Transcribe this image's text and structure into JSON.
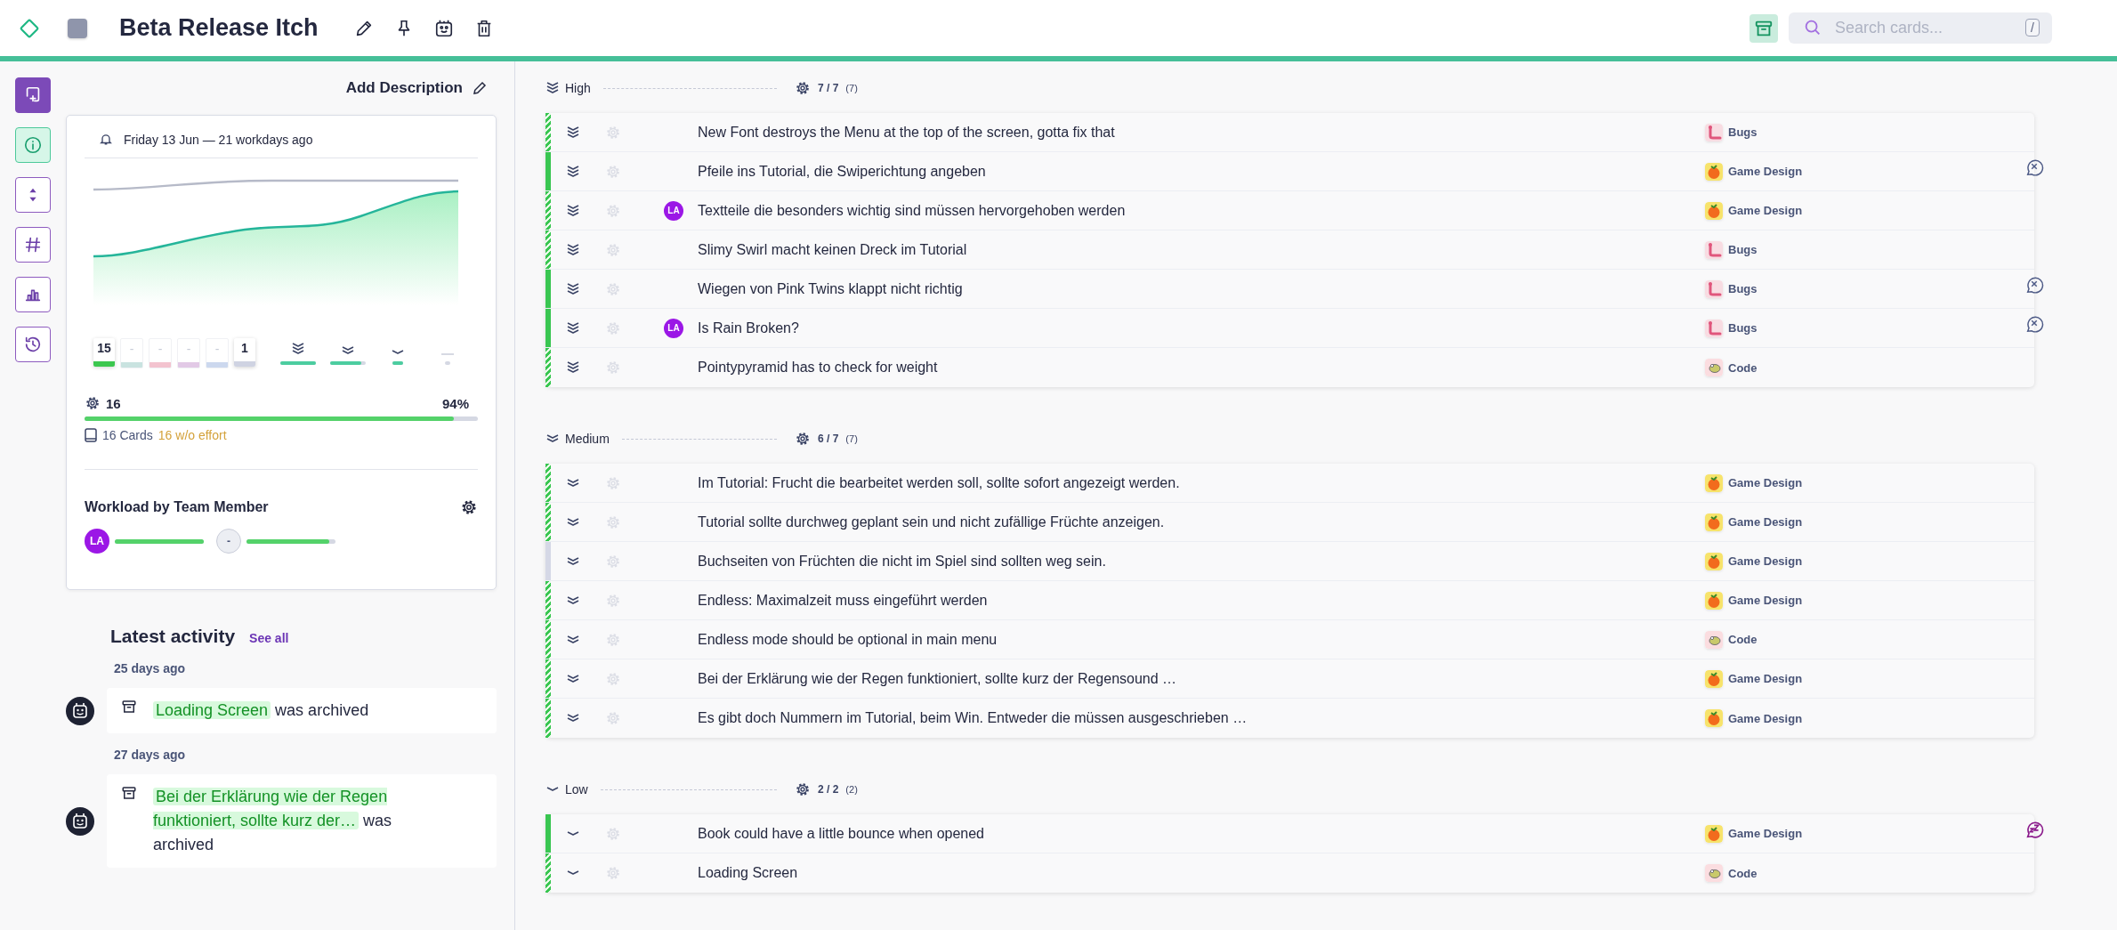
{
  "header": {
    "title": "Beta Release Itch",
    "search": {
      "placeholder": "Search cards...",
      "shortcut": "/"
    }
  },
  "rail": [
    {
      "kind": "action",
      "selected": false
    },
    {
      "kind": "tab",
      "selected": true
    },
    {
      "kind": "tab",
      "selected": false
    },
    {
      "kind": "tab",
      "selected": false
    },
    {
      "kind": "tab",
      "selected": false
    },
    {
      "kind": "tab",
      "selected": false
    }
  ],
  "panel": {
    "add_description": "Add Description",
    "due": "Friday 13 Jun — 21 workdays ago",
    "status_counts": [
      {
        "value": "15",
        "color": "#3cc74f",
        "empty": false
      },
      {
        "value": "-",
        "color": "#c9e3e0",
        "empty": true
      },
      {
        "value": "-",
        "color": "#f3c3cf",
        "empty": true
      },
      {
        "value": "-",
        "color": "#e2c9e6",
        "empty": true
      },
      {
        "value": "-",
        "color": "#ccd8ee",
        "empty": true
      },
      {
        "value": "1",
        "color": "#cfd3e2",
        "empty": false
      }
    ],
    "priority_bars": [
      {
        "kind": "high",
        "level": 1
      },
      {
        "kind": "medium",
        "level": 0.88
      },
      {
        "kind": "low",
        "level": 1
      },
      {
        "kind": "none"
      }
    ],
    "effort": {
      "value": "16",
      "percent": "94%",
      "level": 0.94,
      "cards": "16 Cards",
      "no_effort": "16 w/o effort"
    },
    "workload": {
      "title": "Workload by Team Member",
      "members": [
        {
          "initials": "LA",
          "kind": "user",
          "level": 1
        },
        {
          "initials": "-",
          "kind": "unassigned",
          "level": 0.93
        }
      ]
    },
    "activity": {
      "title": "Latest activity",
      "see_all": "See all",
      "entries": [
        {
          "date": "25 days ago",
          "card": "Loading Screen",
          "action": "was archived"
        },
        {
          "date": "27 days ago",
          "card": "Bei der Erklärung wie der Regen funktioniert, sollte kurz der…",
          "action": "was archived"
        }
      ]
    }
  },
  "groups": [
    {
      "kind": "high",
      "label": "High",
      "done": "7 / 7",
      "total": "(7)",
      "cards": [
        {
          "title": "New Font destroys the Menu at the top of the screen, gotta fix that",
          "tag": {
            "label": "Bugs",
            "kind": "bugs"
          },
          "kind": "striped",
          "blocked": false,
          "snoozed": false
        },
        {
          "title": "Pfeile ins Tutorial, die Swiperichtung angeben",
          "tag": {
            "label": "Game Design",
            "kind": "design"
          },
          "kind": "solid",
          "blocked": true,
          "snoozed": false
        },
        {
          "title": "Textteile die besonders wichtig sind müssen hervorgehoben werden",
          "tag": {
            "label": "Game Design",
            "kind": "design"
          },
          "kind": "striped",
          "assignee": "LA",
          "blocked": false,
          "snoozed": false
        },
        {
          "title": "Slimy Swirl macht keinen Dreck im Tutorial",
          "tag": {
            "label": "Bugs",
            "kind": "bugs"
          },
          "kind": "striped",
          "blocked": false,
          "snoozed": false
        },
        {
          "title": "Wiegen von Pink Twins klappt nicht richtig",
          "tag": {
            "label": "Bugs",
            "kind": "bugs"
          },
          "kind": "solid",
          "blocked": true,
          "snoozed": false
        },
        {
          "title": "Is Rain Broken?",
          "tag": {
            "label": "Bugs",
            "kind": "bugs"
          },
          "kind": "solid",
          "assignee": "LA",
          "blocked": true,
          "snoozed": false
        },
        {
          "title": "Pointypyramid has to check for weight",
          "tag": {
            "label": "Code",
            "kind": "code"
          },
          "kind": "striped",
          "blocked": false,
          "snoozed": false
        }
      ]
    },
    {
      "kind": "medium",
      "label": "Medium",
      "done": "6 / 7",
      "total": "(7)",
      "cards": [
        {
          "title": "Im Tutorial: Frucht die bearbeitet werden soll, sollte sofort angezeigt werden.",
          "tag": {
            "label": "Game Design",
            "kind": "design"
          },
          "kind": "striped",
          "blocked": false,
          "snoozed": false
        },
        {
          "title": "Tutorial sollte durchweg geplant sein und nicht zufällige Früchte anzeigen.",
          "tag": {
            "label": "Game Design",
            "kind": "design"
          },
          "kind": "striped",
          "blocked": false,
          "snoozed": false
        },
        {
          "title": "Buchseiten von Früchten die nicht im Spiel sind sollten weg sein.",
          "tag": {
            "label": "Game Design",
            "kind": "design"
          },
          "kind": "empty",
          "blocked": false,
          "snoozed": false
        },
        {
          "title": "Endless: Maximalzeit muss eingeführt werden",
          "tag": {
            "label": "Game Design",
            "kind": "design"
          },
          "kind": "striped",
          "blocked": false,
          "snoozed": false
        },
        {
          "title": "Endless mode should be optional in main menu",
          "tag": {
            "label": "Code",
            "kind": "code"
          },
          "kind": "striped",
          "blocked": false,
          "snoozed": false
        },
        {
          "title": "Bei der Erklärung wie der Regen funktioniert, sollte kurz der Regensound …",
          "tag": {
            "label": "Game Design",
            "kind": "design"
          },
          "kind": "striped",
          "blocked": false,
          "snoozed": false
        },
        {
          "title": "Es gibt doch Nummern im Tutorial, beim Win. Entweder die müssen ausgeschrieben …",
          "tag": {
            "label": "Game Design",
            "kind": "design"
          },
          "kind": "striped",
          "blocked": false,
          "snoozed": false
        }
      ]
    },
    {
      "kind": "low",
      "label": "Low",
      "done": "2 / 2",
      "total": "(2)",
      "cards": [
        {
          "title": "Book could have a little bounce when opened",
          "tag": {
            "label": "Game Design",
            "kind": "design"
          },
          "kind": "solid",
          "blocked": false,
          "snoozed": true
        },
        {
          "title": "Loading Screen",
          "tag": {
            "label": "Code",
            "kind": "code"
          },
          "kind": "striped",
          "blocked": false,
          "snoozed": false
        }
      ]
    }
  ]
}
